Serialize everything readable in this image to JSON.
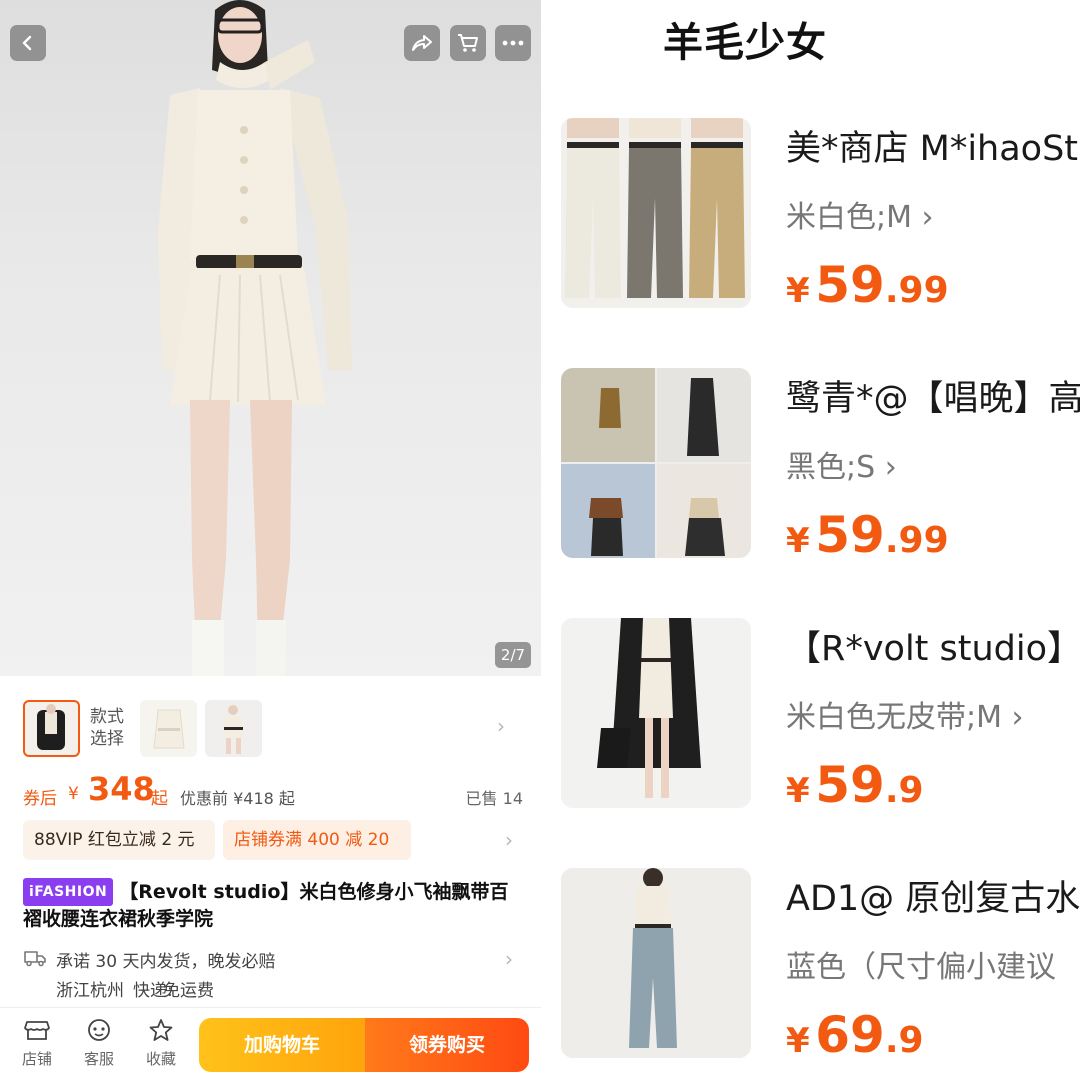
{
  "product": {
    "image_counter": "2/7",
    "style_label": "款式选择",
    "price": {
      "after_coupon_label": "券后",
      "currency": "¥",
      "value": "348",
      "suffix": "起",
      "original": "优惠前 ¥418 起",
      "sold": "已售 14"
    },
    "coupons": {
      "vip": "88VIP 红包立减 2 元",
      "store": "店铺券满 400 减 20"
    },
    "badge": "iFASHION",
    "title": "【Revolt studio】米白色修身小飞袖飘带百褶收腰连衣裙秋季学院",
    "shipping": {
      "promise": "承诺 30 天内发货，晚发必赔",
      "origin": "浙江杭州",
      "method_label": "快递:",
      "method": "免运费"
    },
    "bottom_bar": {
      "store": "店铺",
      "service": "客服",
      "favorite": "收藏",
      "add_cart": "加购物车",
      "buy": "领券购买"
    }
  },
  "list": {
    "title": "羊毛少女",
    "items": [
      {
        "name": "美*商店 M*ihaoSt",
        "spec": "米白色;M",
        "currency": "¥",
        "price_int": "59",
        "price_dec": ".99"
      },
      {
        "name": "鹭青*@【唱晚】高",
        "spec": "黑色;S",
        "currency": "¥",
        "price_int": "59",
        "price_dec": ".99"
      },
      {
        "name": "【R*volt studio】",
        "spec": "米白色无皮带;M",
        "currency": "¥",
        "price_int": "59",
        "price_dec": ".9"
      },
      {
        "name": "AD1@ 原创复古水",
        "spec": "蓝色（尺寸偏小建议",
        "currency": "¥",
        "price_int": "69",
        "price_dec": ".9"
      }
    ]
  },
  "icons": [
    "back-icon",
    "share-icon",
    "cart-icon",
    "more-icon",
    "chevron-right-icon",
    "truck-icon",
    "store-icon",
    "service-icon",
    "star-icon"
  ],
  "colors": {
    "accent": "#f25a12",
    "badge": "#8a3ef0",
    "cart_button": "#ffb312",
    "buy_button": "#ff5a14"
  }
}
